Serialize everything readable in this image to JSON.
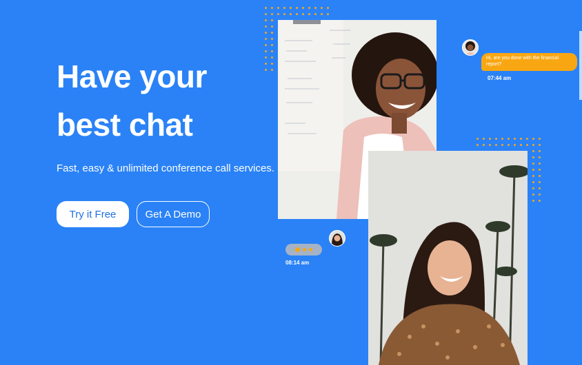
{
  "hero": {
    "title_line1": "Have your",
    "title_line2": "best chat",
    "subtitle": "Fast, easy & unlimited conference call services."
  },
  "buttons": {
    "primary": "Try it Free",
    "secondary": "Get A Demo"
  },
  "chat": {
    "message": "Hi, are you done with the financial report?",
    "message_time": "07:44 am",
    "typing_time": "08:14 am"
  },
  "colors": {
    "background": "#2a82f6",
    "accent": "#f8a713",
    "button_text": "#1f6fe0"
  },
  "icons": [
    "avatar-woman-glasses",
    "avatar-woman-smiling",
    "typing-dots"
  ]
}
